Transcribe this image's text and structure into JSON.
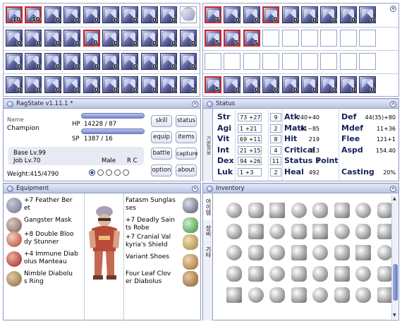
{
  "skill_bar": {
    "left_rows": [
      [
        "10",
        "10",
        "0",
        "0",
        "0",
        "0",
        "0",
        "0",
        "0",
        ""
      ],
      [
        "0",
        "0",
        "0",
        "0",
        "0",
        "0",
        "0",
        "0",
        "0",
        "0"
      ],
      [
        "0",
        "0",
        "0",
        "0",
        "0",
        "0",
        "0",
        "0",
        "0",
        "0"
      ],
      [
        "0",
        "0",
        "0",
        "0",
        "0",
        "0",
        "0",
        "0",
        "0",
        "0"
      ]
    ],
    "right_rows": [
      [
        "3",
        "0",
        "0",
        "0",
        "0",
        "0",
        "0",
        "0",
        "0"
      ],
      [
        "5",
        "5",
        "5",
        "",
        "",
        "",
        "",
        "",
        ""
      ],
      [
        "",
        "",
        "",
        "",
        "",
        "",
        "",
        "",
        ""
      ],
      [
        "5",
        "0",
        "0",
        "0",
        "0",
        "0",
        "0",
        "0",
        "0"
      ]
    ]
  },
  "ragstate": {
    "title": "RagState v1.11.1 *",
    "name_label": "Name",
    "job_name": "Champion",
    "hp_label": "HP",
    "hp_value": "14228 / 87",
    "sp_label": "SP",
    "sp_value": "1387 / 16",
    "base_lv": "Base Lv.99",
    "job_lv": "Job Lv.70",
    "gender": "Male",
    "rc": "R C",
    "weight": "Weight:415/4790",
    "buttons": [
      "skill",
      "status",
      "equip",
      "items",
      "battle",
      "capture",
      "option",
      "about"
    ]
  },
  "status": {
    "title": "Status",
    "stats": [
      {
        "name": "Str",
        "value": "73 +27",
        "points": "9"
      },
      {
        "name": "Agi",
        "value": "1 +21",
        "points": "2"
      },
      {
        "name": "Vit",
        "value": "69 +11",
        "points": "8"
      },
      {
        "name": "Int",
        "value": "21 +15",
        "points": "4"
      },
      {
        "name": "Dex",
        "value": "94 +26",
        "points": "11"
      },
      {
        "name": "Luk",
        "value": "1 +3",
        "points": "2"
      }
    ],
    "mid": [
      {
        "name": "Atk",
        "value": "240+40"
      },
      {
        "name": "Matk",
        "value": "61~85"
      },
      {
        "name": "Hit",
        "value": "219"
      },
      {
        "name": "Critical",
        "value": "2.3"
      },
      {
        "name": "Status Point",
        "value": "0"
      },
      {
        "name": "Heal",
        "value": "492"
      }
    ],
    "right": [
      {
        "name": "Def",
        "value": "44(35)+80"
      },
      {
        "name": "Mdef",
        "value": "11+36"
      },
      {
        "name": "Flee",
        "value": "121+1"
      },
      {
        "name": "Aspd",
        "value": "154.40"
      },
      {
        "name": "Casting",
        "value": "20%"
      }
    ]
  },
  "equipment": {
    "title": "Equipment",
    "left": [
      "+7 Feather Beret",
      "Gangster Mask",
      "+8 Double Bloody Stunner",
      "+4 Immune Diabolus Manteau",
      "Nimble Diabolus Ring"
    ],
    "left_lines": [
      [
        "+7 Feather Ber",
        "et"
      ],
      [
        "Gangster Mask"
      ],
      [
        "+8 Double Bloo",
        "dy Stunner"
      ],
      [
        "+4 Immune Diab",
        "olus Manteau"
      ],
      [
        "Nimble Diabolu",
        "s Ring"
      ]
    ],
    "right_lines": [
      [
        "Fatasm Sunglas",
        "ses"
      ],
      [
        "+7 Deadly Sain",
        "ts Robe"
      ],
      [
        "+7 Cranial Val",
        "kyria's Shield"
      ],
      [
        "Variant Shoes"
      ],
      [
        "Four Leaf Clov",
        "er Diabolus"
      ]
    ]
  },
  "inventory": {
    "title": "Inventory",
    "tabs": [
      "아이템",
      "장비",
      "기타"
    ]
  }
}
